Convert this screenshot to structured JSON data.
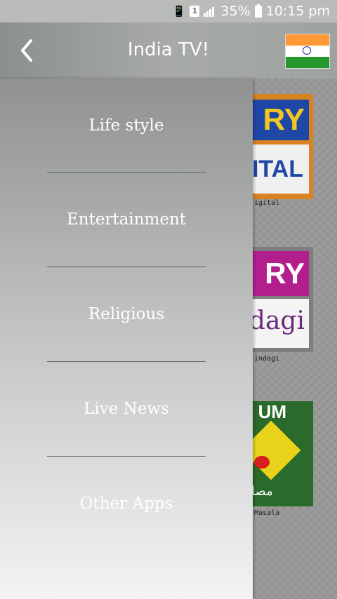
{
  "status_bar": {
    "battery_text": "35%",
    "time": "10:15 pm",
    "sim_label": "1"
  },
  "app_bar": {
    "title": "India TV!",
    "back_icon": "chevron-left-icon",
    "flag_icon": "india-flag-icon"
  },
  "drawer": {
    "items": [
      {
        "label": "Life style"
      },
      {
        "label": "Entertainment"
      },
      {
        "label": "Religious"
      },
      {
        "label": "Live News"
      },
      {
        "label": "Other Apps"
      }
    ]
  },
  "channels": [
    {
      "top": "RY",
      "bottom": "ITAL",
      "caption": "igital"
    },
    {
      "top": "RY",
      "bottom": "dagi",
      "caption": "indagi"
    },
    {
      "top": "UM",
      "bottom": "مصا",
      "caption": "Masala"
    }
  ],
  "colors": {
    "drawer_text": "#ffffff",
    "divider": "#5c6470",
    "accent_orange": "#ff9933",
    "accent_green": "#27992c"
  }
}
